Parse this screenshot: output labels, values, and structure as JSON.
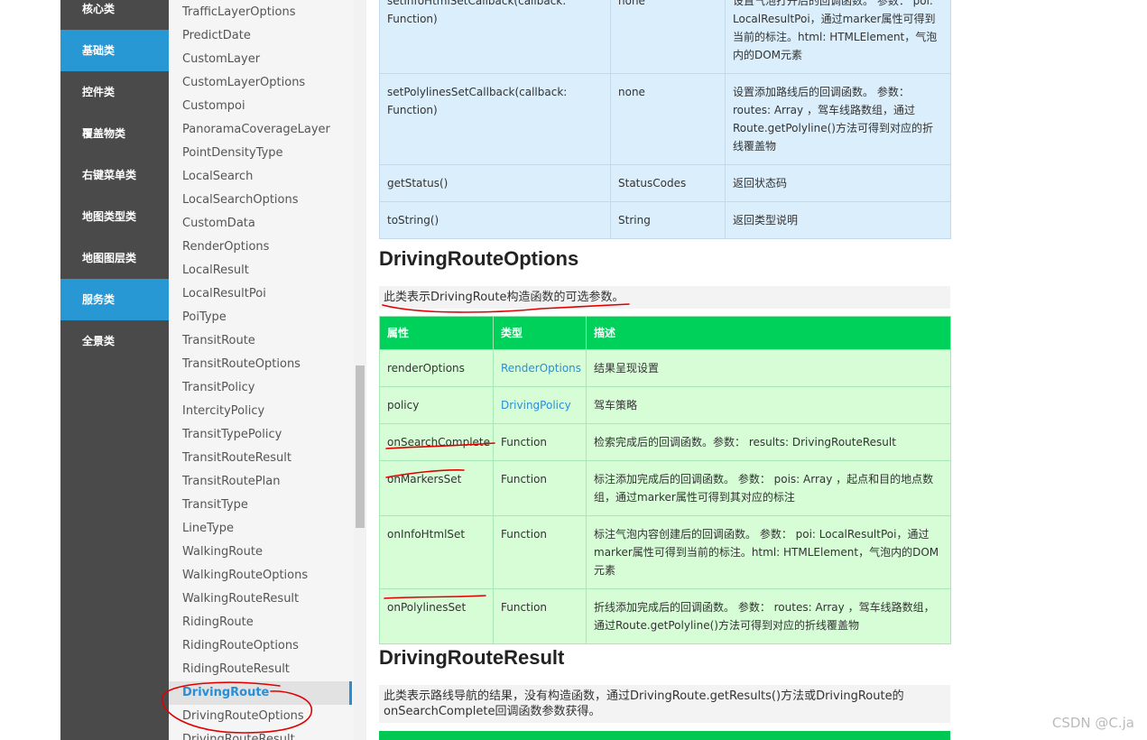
{
  "categories": [
    "核心类",
    "基础类",
    "控件类",
    "覆盖物类",
    "右键菜单类",
    "地图类型类",
    "地图图层类",
    "服务类",
    "全景类"
  ],
  "classes": [
    "TrafficLayerOptions",
    "PredictDate",
    "CustomLayer",
    "CustomLayerOptions",
    "Custompoi",
    "PanoramaCoverageLayer",
    "PointDensityType",
    "LocalSearch",
    "LocalSearchOptions",
    "CustomData",
    "RenderOptions",
    "LocalResult",
    "LocalResultPoi",
    "PoiType",
    "TransitRoute",
    "TransitRouteOptions",
    "TransitPolicy",
    "IntercityPolicy",
    "TransitTypePolicy",
    "TransitRouteResult",
    "TransitRoutePlan",
    "TransitType",
    "LineType",
    "WalkingRoute",
    "WalkingRouteOptions",
    "WalkingRouteResult",
    "RidingRoute",
    "RidingRouteOptions",
    "RidingRouteResult",
    "DrivingRoute",
    "DrivingRouteOptions",
    "DrivingRouteResult"
  ],
  "methods_table": {
    "rows": [
      {
        "name": "setInfoHtmlSetCallback(callback: Function)",
        "ret": "none",
        "desc": "设置气泡打开后的回调函数。 参数： poi: LocalResultPoi，通过marker属性可得到当前的标注。html: HTMLElement，气泡内的DOM元素"
      },
      {
        "name": "setPolylinesSetCallback(callback: Function)",
        "ret": "none",
        "desc": "设置添加路线后的回调函数。 参数： routes: Array ，驾车线路数组，通过Route.getPolyline()方法可得到对应的折线覆盖物"
      },
      {
        "name": "getStatus()",
        "ret": "StatusCodes",
        "desc": "返回状态码"
      },
      {
        "name": "toString()",
        "ret": "String",
        "desc": "返回类型说明"
      }
    ]
  },
  "options_section": {
    "title": "DrivingRouteOptions",
    "desc": "此类表示DrivingRoute构造函数的可选参数。",
    "headers": [
      "属性",
      "类型",
      "描述"
    ],
    "rows": [
      {
        "name": "renderOptions",
        "type": "RenderOptions",
        "desc": "结果呈现设置"
      },
      {
        "name": "policy",
        "type": "DrivingPolicy",
        "desc": "驾车策略"
      },
      {
        "name": "onSearchComplete",
        "type": "Function",
        "desc": "检索完成后的回调函数。参数： results: DrivingRouteResult"
      },
      {
        "name": "onMarkersSet",
        "type": "Function",
        "desc": "标注添加完成后的回调函数。 参数： pois: Array ，起点和目的地点数组，通过marker属性可得到其对应的标注"
      },
      {
        "name": "onInfoHtmlSet",
        "type": "Function",
        "desc": "标注气泡内容创建后的回调函数。 参数： poi: LocalResultPoi，通过marker属性可得到当前的标注。html: HTMLElement，气泡内的DOM元素"
      },
      {
        "name": "onPolylinesSet",
        "type": "Function",
        "desc": "折线添加完成后的回调函数。 参数： routes: Array ，驾车线路数组，通过Route.getPolyline()方法可得到对应的折线覆盖物"
      }
    ]
  },
  "result_section": {
    "title": "DrivingRouteResult",
    "desc": "此类表示路线导航的结果，没有构造函数，通过DrivingRoute.getResults()方法或DrivingRoute的onSearchComplete回调函数参数获得。"
  },
  "watermark": "CSDN @C.ja",
  "colors": {
    "nav_bg": "#4a4a4a",
    "nav_active": "#2798d4",
    "link": "#2a8ed6",
    "table_header": "#00d15a",
    "annotation": "#e00000"
  }
}
